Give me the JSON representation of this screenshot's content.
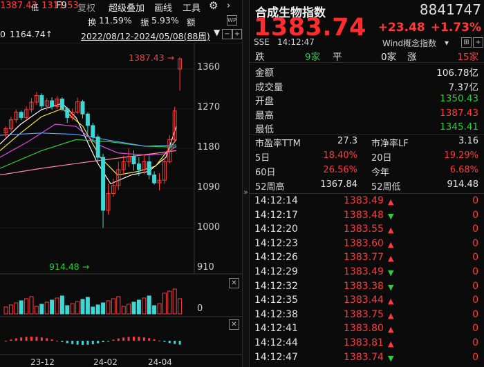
{
  "colors": {
    "up": "#ff3b3b",
    "down": "#2ecc40",
    "ma5": "#ffffff",
    "ma10": "#f5e44a",
    "ma20": "#d94be0",
    "ma60": "#2ecc40",
    "ma120": "#5aa0ff"
  },
  "toolbar": {
    "high_value": "1387.43",
    "low_label": "低",
    "low_value": "1311.53",
    "f9": "F9",
    "fuquan": "复权",
    "overlay": "超级叠加",
    "draw": "画线",
    "tools": "工具",
    "turnover_label": "换",
    "turnover_value": "11.59%",
    "amplitude_label": "振",
    "amplitude_value": "5.93%",
    "amount_label": "额"
  },
  "range_bar": {
    "zero": "0",
    "low_mark": "1164.74↑",
    "range": "2022/08/12-2024/05/08(88周)",
    "dropdown_icon": "caret-down-icon"
  },
  "kline": {
    "price_axis": [
      "1360",
      "1270",
      "1180",
      "1090",
      "1000",
      "910"
    ],
    "max_label": "1387.43 →",
    "min_label": "914.48 →",
    "volume_axis": "0",
    "date_axis": [
      "23-12",
      "24-02",
      "24-04"
    ]
  },
  "quote": {
    "name": "合成生物指数",
    "code": "8841747",
    "price": "1383.74",
    "change": "+23.48",
    "change_pct": "+1.73%",
    "exchange": "SSE",
    "time": "14:12:47",
    "concept": "Wind概念指数",
    "breadth": {
      "down_label": "跌",
      "down_count": "9家",
      "flat_label": "平",
      "flat_count": "0家",
      "up_label": "涨",
      "up_count": "15家"
    },
    "stats": [
      {
        "label": "金额",
        "value": "106.78亿",
        "color": "#e6e6e6"
      },
      {
        "label": "成交量",
        "value": "7.37亿",
        "color": "#e6e6e6"
      },
      {
        "label": "开盘",
        "value": "1350.43",
        "color": "#2ecc40"
      },
      {
        "label": "最高",
        "value": "1387.43",
        "color": "#ff3b3b"
      },
      {
        "label": "最低",
        "value": "1345.41",
        "color": "#2ecc40"
      }
    ],
    "valuation": [
      {
        "l1": "市盈率TTM",
        "v1": "27.3",
        "c1": "#e6e6e6",
        "l2": "市净率LF",
        "v2": "3.16",
        "c2": "#e6e6e6"
      },
      {
        "l1": "5日",
        "v1": "18.40%",
        "c1": "#ff3b3b",
        "l2": "20日",
        "v2": "19.29%",
        "c2": "#ff3b3b"
      },
      {
        "l1": "60日",
        "v1": "26.56%",
        "c1": "#ff3b3b",
        "l2": "今年",
        "v2": "6.68%",
        "c2": "#ff3b3b"
      },
      {
        "l1": "52周高",
        "v1": "1367.84",
        "c1": "#e6e6e6",
        "l2": "52周低",
        "v2": "914.48",
        "c2": "#e6e6e6"
      }
    ]
  },
  "ticks": [
    {
      "time": "14:12:14",
      "price": "1383.49",
      "dir": "up",
      "vol": "0"
    },
    {
      "time": "14:12:17",
      "price": "1383.48",
      "dir": "down",
      "vol": "0"
    },
    {
      "time": "14:12:20",
      "price": "1383.55",
      "dir": "up",
      "vol": "0"
    },
    {
      "time": "14:12:23",
      "price": "1383.60",
      "dir": "up",
      "vol": "0"
    },
    {
      "time": "14:12:26",
      "price": "1383.77",
      "dir": "up",
      "vol": "0"
    },
    {
      "time": "14:12:29",
      "price": "1383.49",
      "dir": "down",
      "vol": "0"
    },
    {
      "time": "14:12:32",
      "price": "1383.38",
      "dir": "down",
      "vol": "0"
    },
    {
      "time": "14:12:35",
      "price": "1383.44",
      "dir": "up",
      "vol": "0"
    },
    {
      "time": "14:12:38",
      "price": "1383.75",
      "dir": "up",
      "vol": "0"
    },
    {
      "time": "14:12:41",
      "price": "1383.80",
      "dir": "up",
      "vol": "0"
    },
    {
      "time": "14:12:44",
      "price": "1383.81",
      "dir": "up",
      "vol": "0"
    },
    {
      "time": "14:12:47",
      "price": "1383.74",
      "dir": "down",
      "vol": "0"
    }
  ]
}
